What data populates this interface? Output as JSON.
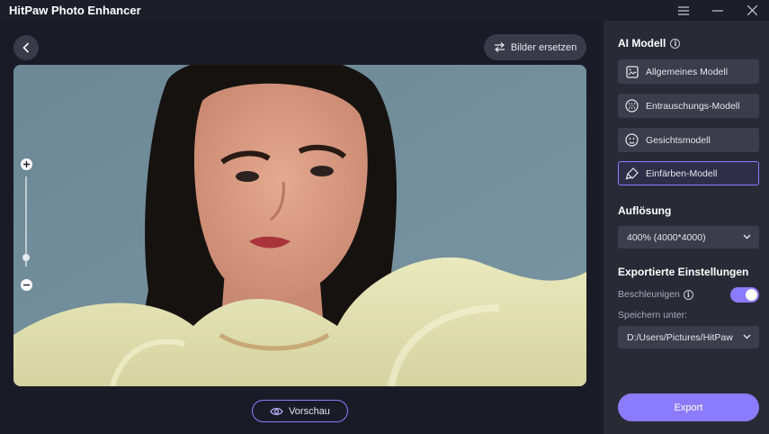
{
  "app": {
    "title": "HitPaw Photo Enhancer"
  },
  "window_controls": [
    {
      "name": "menu-icon",
      "glyph": "☰"
    },
    {
      "name": "minimize-icon",
      "glyph": "—"
    },
    {
      "name": "close-icon",
      "glyph": "✕"
    }
  ],
  "toolbar": {
    "replace_label": "Bilder ersetzen"
  },
  "preview": {
    "label": "Vorschau"
  },
  "zoom": {
    "level": 0.1
  },
  "panel": {
    "ai_model_title": "AI Modell",
    "models": [
      {
        "label": "Allgemeines Modell",
        "icon": "image-icon",
        "active": false
      },
      {
        "label": "Entrauschungs-Modell",
        "icon": "denoise-icon",
        "active": false
      },
      {
        "label": "Gesichtsmodell",
        "icon": "face-icon",
        "active": false
      },
      {
        "label": "Einfärben-Modell",
        "icon": "colorize-icon",
        "active": true
      }
    ],
    "resolution_title": "Auflösung",
    "resolution_value": "400% (4000*4000)",
    "export_settings_title": "Exportierte Einstellungen",
    "accelerate_label": "Beschleunigen",
    "accelerate_on": true,
    "save_to_label": "Speichern unter:",
    "save_path": "D:/Users/Pictures/HitPaw",
    "export_label": "Export"
  },
  "colors": {
    "accent": "#8b7cff",
    "panel": "#2a2a37",
    "background": "#1b1b27"
  }
}
